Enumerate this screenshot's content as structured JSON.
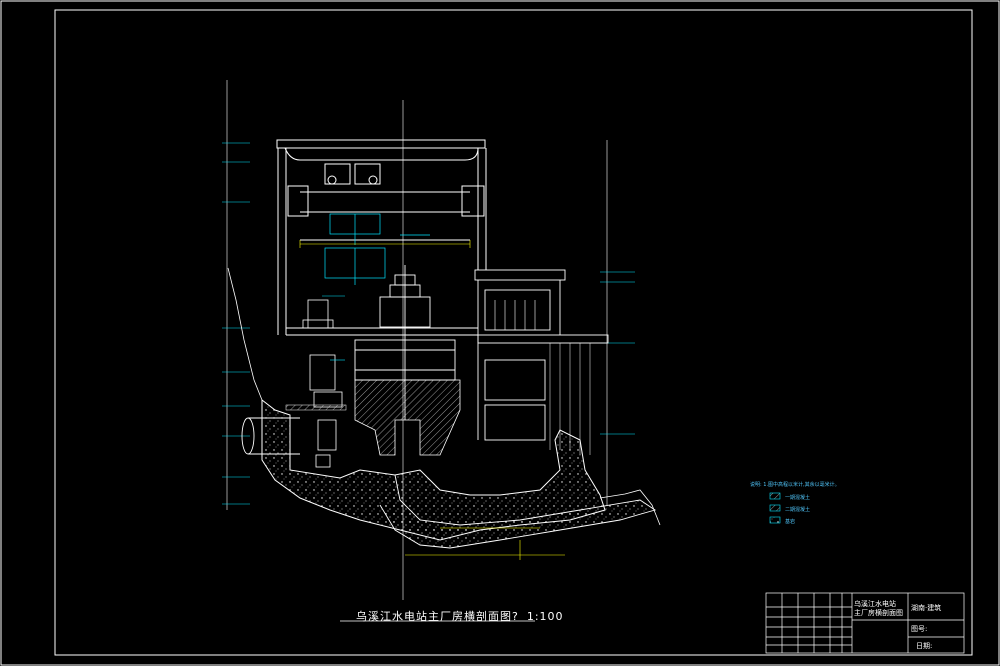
{
  "drawing": {
    "title": "乌溪江水电站主厂房横剖面图",
    "title_suffix": "?",
    "scale": "1:100"
  },
  "colors": {
    "background": "#000000",
    "frame": "#ffffff",
    "structure": "#ffffff",
    "annotation": "#00e5ff",
    "dimension": "#ffff00",
    "concrete_hatch": "#ffffff",
    "rock_hatch": "#ffffff",
    "equipment": "#ffffff"
  },
  "title_block": {
    "project_name_line1": "乌溪江水电站",
    "project_name_line2": "主厂房横剖面图",
    "school": "湖南·建筑",
    "drawing_no_label": "图号:",
    "date_label": "日期:"
  },
  "legend": {
    "line1": "说明: 1.图中高程以米计,其余以毫米计。",
    "line2": "一期混凝土",
    "line3": "二期混凝土",
    "line4": "基岩"
  }
}
